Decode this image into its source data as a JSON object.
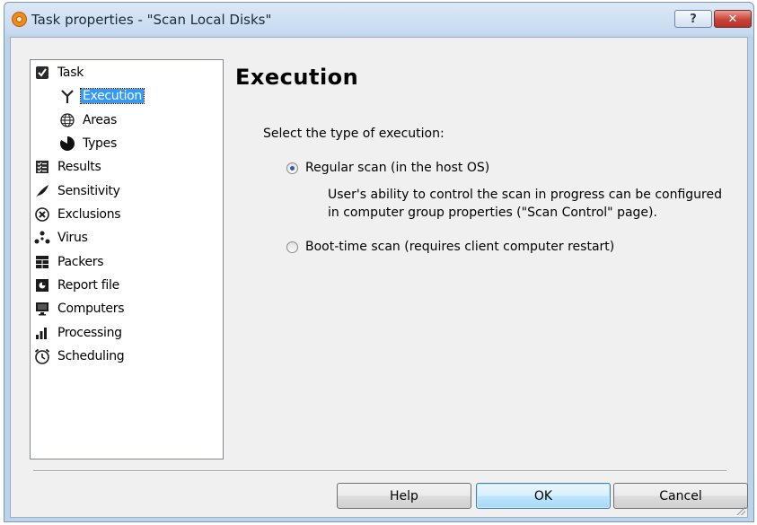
{
  "window": {
    "title": "Task properties - \"Scan Local Disks\"",
    "help_button": "?",
    "close_button": "✕"
  },
  "tree": {
    "items": [
      {
        "label": "Task",
        "icon": "task-check-icon",
        "level": 0
      },
      {
        "label": "Execution",
        "icon": "execution-fork-icon",
        "level": 1,
        "selected": true
      },
      {
        "label": "Areas",
        "icon": "globe-icon",
        "level": 1
      },
      {
        "label": "Types",
        "icon": "types-pie-icon",
        "level": 1
      },
      {
        "label": "Results",
        "icon": "results-checklist-icon",
        "level": 0
      },
      {
        "label": "Sensitivity",
        "icon": "feather-icon",
        "level": 0
      },
      {
        "label": "Exclusions",
        "icon": "exclusion-x-icon",
        "level": 0
      },
      {
        "label": "Virus",
        "icon": "virus-icon",
        "level": 0
      },
      {
        "label": "Packers",
        "icon": "packers-grid-icon",
        "level": 0
      },
      {
        "label": "Report file",
        "icon": "report-file-icon",
        "level": 0
      },
      {
        "label": "Computers",
        "icon": "monitor-icon",
        "level": 0
      },
      {
        "label": "Processing",
        "icon": "bar-chart-icon",
        "level": 0
      },
      {
        "label": "Scheduling",
        "icon": "alarm-clock-icon",
        "level": 0
      }
    ]
  },
  "content": {
    "heading": "Execution",
    "prompt": "Select the type of execution:",
    "options": [
      {
        "label": "Regular scan (in the host OS)",
        "checked": true
      },
      {
        "label": "Boot-time scan (requires client computer restart)",
        "checked": false
      }
    ],
    "description_line1": "User's ability to control the scan in progress can be configured",
    "description_line2": "in computer group properties (\"Scan Control\" page)."
  },
  "buttons": {
    "help": "Help",
    "ok": "OK",
    "cancel": "Cancel"
  },
  "colors": {
    "selection": "#3399ff",
    "dialog_background": "#f0f0f0",
    "close_button": "#c7443a"
  }
}
